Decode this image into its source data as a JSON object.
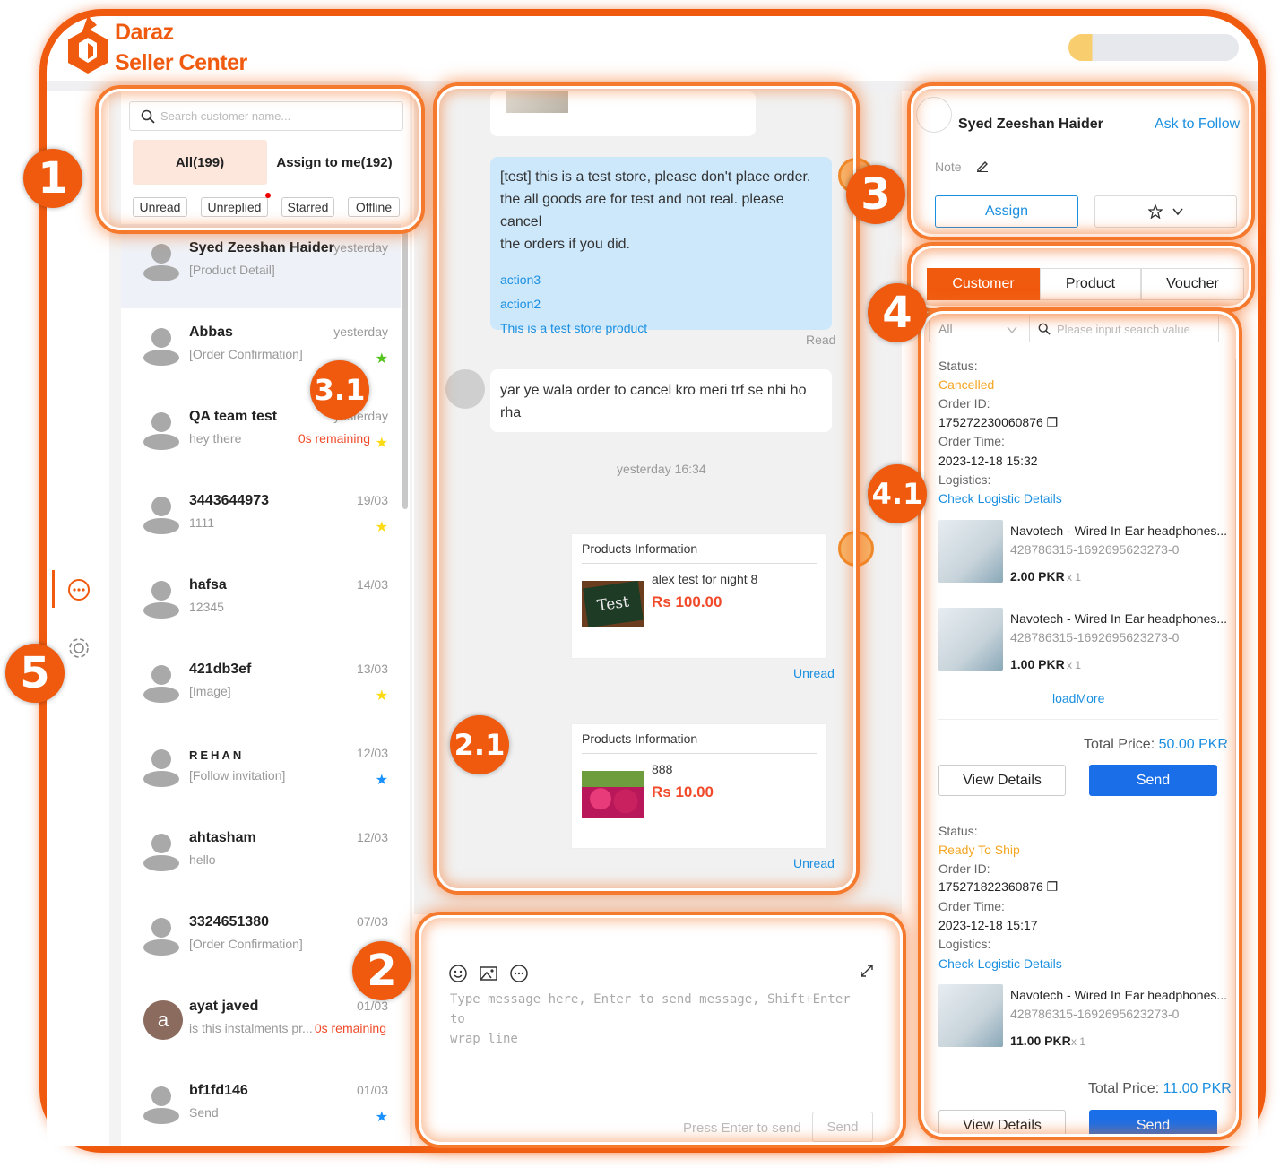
{
  "brand": {
    "line1": "Daraz",
    "line2": "Seller Center"
  },
  "colors": {
    "accent": "#f05a0f",
    "link": "#1a8fe0",
    "primary": "#1a6fe8",
    "warning": "#f5a623"
  },
  "sidebar": {
    "icons": [
      "chat-icon",
      "settings-icon"
    ]
  },
  "conversation_list": {
    "search_placeholder": "Search customer name...",
    "tabs": [
      "All(199)",
      "Assign to me(192)"
    ],
    "filters": [
      "Unread",
      "Unreplied",
      "Starred",
      "Offline"
    ],
    "items": [
      {
        "name": "Syed Zeeshan Haider",
        "time": "yesterday",
        "msg": "[Product Detail]",
        "star": "",
        "remaining": ""
      },
      {
        "name": "Abbas",
        "time": "yesterday",
        "msg": "[Order Confirmation]",
        "star": "green",
        "remaining": ""
      },
      {
        "name": "QA team test",
        "time": "yesterday",
        "msg": "hey there",
        "star": "yellow",
        "remaining": "0s remaining"
      },
      {
        "name": "3443644973",
        "time": "19/03",
        "msg": "1111",
        "star": "yellow",
        "remaining": ""
      },
      {
        "name": "hafsa",
        "time": "14/03",
        "msg": "12345",
        "star": "",
        "remaining": ""
      },
      {
        "name": "421db3ef",
        "time": "13/03",
        "msg": "[Image]",
        "star": "yellow",
        "remaining": ""
      },
      {
        "name": "REHAN",
        "time": "12/03",
        "msg": "[Follow invitation]",
        "star": "blue",
        "remaining": ""
      },
      {
        "name": "ahtasham",
        "time": "12/03",
        "msg": "hello",
        "star": "",
        "remaining": ""
      },
      {
        "name": "3324651380",
        "time": "07/03",
        "msg": "[Order Confirmation]",
        "star": "",
        "remaining": ""
      },
      {
        "name": "ayat javed",
        "time": "01/03",
        "msg": "is this instalments pr...",
        "star": "",
        "remaining": "0s remaining",
        "avatar_letter": "a"
      },
      {
        "name": "bf1fd146",
        "time": "01/03",
        "msg": "Send",
        "star": "blue",
        "remaining": ""
      }
    ]
  },
  "chat": {
    "store_message": {
      "line1": "[test] this is a test store, please don't place order.",
      "line2": "the all goods are for test and not real. please cancel",
      "line3": "the orders if you did.",
      "links": [
        "action3",
        "action2",
        "This is a test store product"
      ],
      "status": "Read"
    },
    "customer_message": {
      "line1": "yar ye wala order to cancel kro meri trf se nhi ho",
      "line2": "rha"
    },
    "timestamp": "yesterday 16:34",
    "product_cards": [
      {
        "title": "Products Information",
        "name": "alex test for night 8",
        "price": "Rs 100.00",
        "status": "Unread",
        "image_text": "Test"
      },
      {
        "title": "Products Information",
        "name": "888",
        "price": "Rs 10.00",
        "status": "Unread"
      }
    ]
  },
  "input": {
    "placeholder_line1": "Type message here, Enter to send message, Shift+Enter to",
    "placeholder_line2": "wrap line",
    "hint": "Press Enter to send",
    "send": "Send"
  },
  "customer_panel": {
    "name": "Syed Zeeshan Haider",
    "ask_follow": "Ask to Follow",
    "note_label": "Note",
    "assign": "Assign"
  },
  "right_tabs": [
    "Customer",
    "Product",
    "Voucher"
  ],
  "order_filter": {
    "select": "All",
    "search_placeholder": "Please input search value"
  },
  "orders": [
    {
      "status_label": "Status:",
      "status": "Cancelled",
      "id_label": "Order ID:",
      "id": "175272230060876",
      "time_label": "Order Time:",
      "time": "2023-12-18 15:32",
      "logistics_label": "Logistics:",
      "logistics_link": "Check Logistic Details",
      "items": [
        {
          "name": "Navotech - Wired In Ear headphones...",
          "sku": "428786315-1692695623273-0",
          "price": "2.00 PKR",
          "qty": "x 1"
        },
        {
          "name": "Navotech - Wired In Ear headphones...",
          "sku": "428786315-1692695623273-0",
          "price": "1.00 PKR",
          "qty": "x 1"
        }
      ],
      "load_more": "loadMore",
      "total_label": "Total Price:",
      "total": "50.00 PKR",
      "view": "View Details",
      "send": "Send"
    },
    {
      "status_label": "Status:",
      "status": "Ready To Ship",
      "id_label": "Order ID:",
      "id": "175271822360876",
      "time_label": "Order Time:",
      "time": "2023-12-18 15:17",
      "logistics_label": "Logistics:",
      "logistics_link": "Check Logistic Details",
      "items": [
        {
          "name": "Navotech - Wired In Ear headphones...",
          "sku": "428786315-1692695623273-0",
          "price": "11.00 PKR",
          "qty": "x 1"
        }
      ],
      "total_label": "Total Price:",
      "total": "11.00 PKR",
      "view": "View Details",
      "send": "Send"
    }
  ],
  "annotations": [
    "1",
    "2",
    "2.1",
    "3",
    "3.1",
    "4",
    "4.1",
    "5"
  ]
}
